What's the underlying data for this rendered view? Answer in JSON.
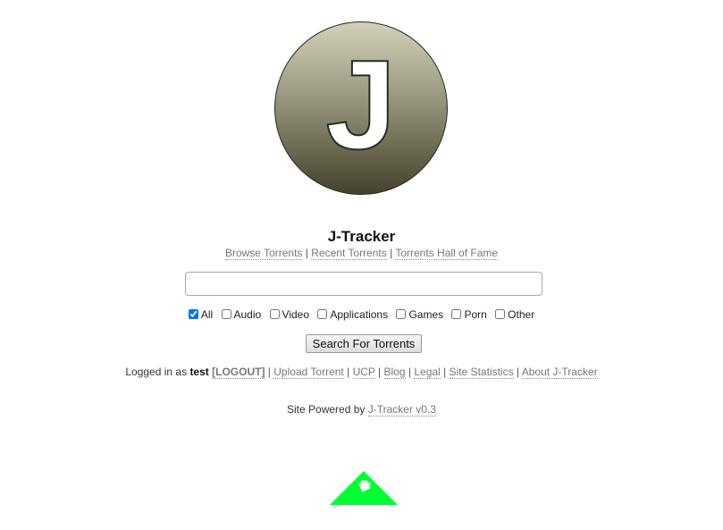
{
  "logo": {
    "letter": "J"
  },
  "site_title": "J-Tracker",
  "nav": [
    "Browse Torrents",
    "Recent Torrents",
    "Torrents Hall of Fame"
  ],
  "search": {
    "value": "",
    "placeholder": "",
    "button_label": "Search For Torrents"
  },
  "categories": [
    {
      "label": "All",
      "checked": true
    },
    {
      "label": "Audio",
      "checked": false
    },
    {
      "label": "Video",
      "checked": false
    },
    {
      "label": "Applications",
      "checked": false
    },
    {
      "label": "Games",
      "checked": false
    },
    {
      "label": "Porn",
      "checked": false
    },
    {
      "label": "Other",
      "checked": false
    }
  ],
  "user_bar": {
    "logged_in_prefix": "Logged in as",
    "username": "test",
    "logout_label": "[LOGOUT]",
    "links": [
      "Upload Torrent",
      "UCP",
      "Blog",
      "Legal",
      "Site Statistics",
      "About J-Tracker"
    ]
  },
  "powered": {
    "prefix": "Site Powered by",
    "link": "J-Tracker v0.3"
  },
  "colors": {
    "badge_green": "#00ff33",
    "link_gray": "#777777"
  },
  "badge": {
    "icon": "puzzle-icon"
  }
}
